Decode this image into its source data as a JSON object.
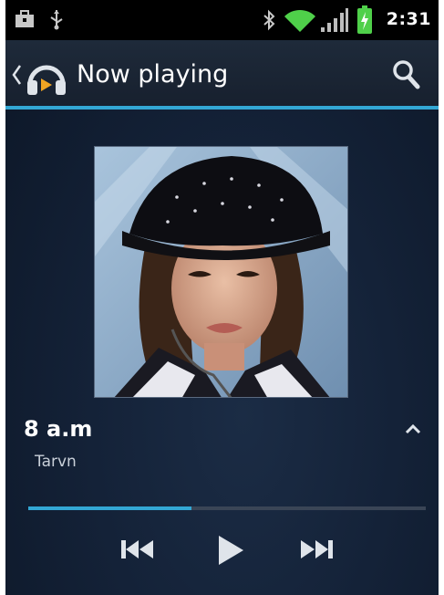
{
  "status_bar": {
    "time": "2:31",
    "icons": [
      "briefcase-icon",
      "usb-icon",
      "bluetooth-icon",
      "wifi-icon",
      "signal-icon",
      "battery-charging-icon"
    ]
  },
  "action_bar": {
    "title": "Now playing",
    "app_icon": "headphones-icon",
    "action_icon": "search-icon"
  },
  "track": {
    "title": "8 a.m",
    "artist": "Tarvn",
    "progress": 0.41
  },
  "controls": {
    "icons": [
      "previous-icon",
      "play-icon",
      "next-icon"
    ]
  },
  "colors": {
    "accent": "#33a7d4",
    "background": "#142238",
    "status_bar": "#000000"
  }
}
